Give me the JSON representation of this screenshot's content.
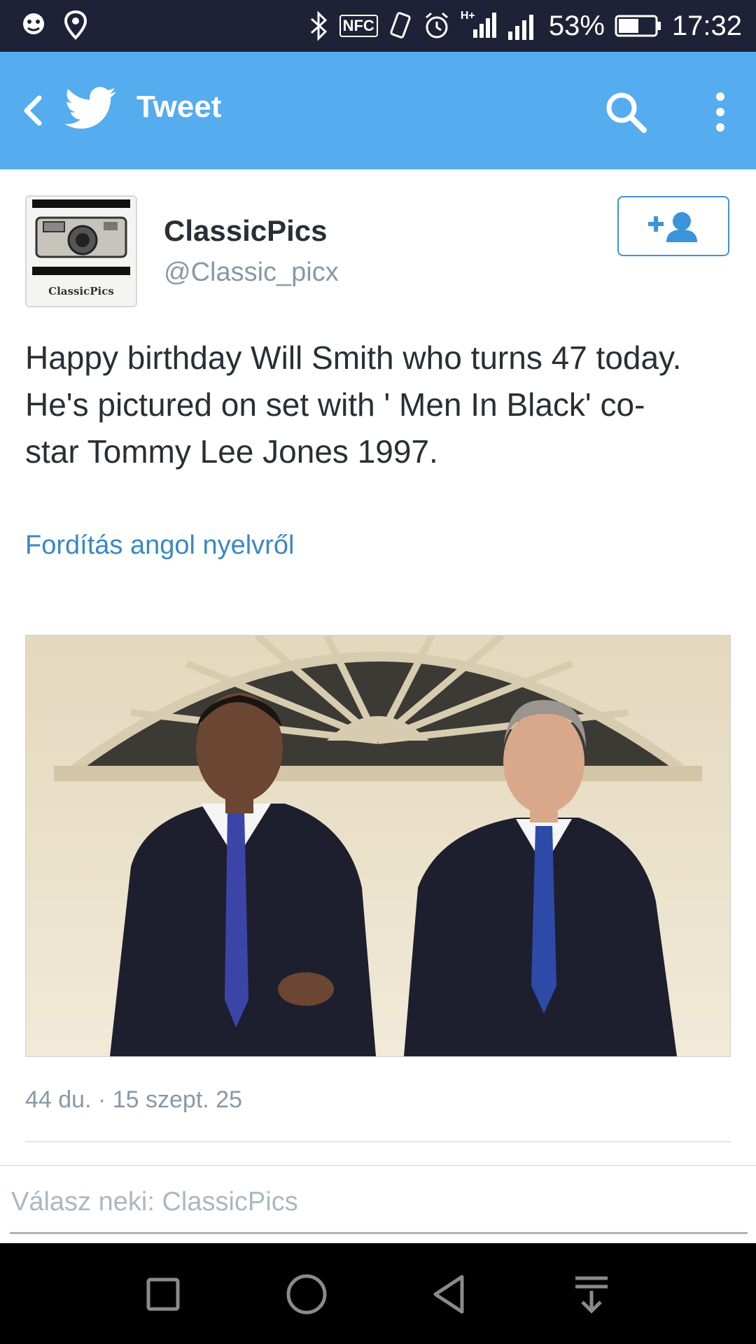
{
  "status_bar": {
    "nfc_label": "NFC",
    "network_label": "H+",
    "battery_percent": "53%",
    "time": "17:32",
    "icons": [
      "notification-icon",
      "location-icon",
      "bluetooth-icon",
      "nfc-icon",
      "vibrate-icon",
      "alarm-icon",
      "signal-icon",
      "signal-icon",
      "battery-icon"
    ]
  },
  "app_bar": {
    "title": "Tweet",
    "background_color": "#55acee",
    "icons": [
      "back-arrow-icon",
      "twitter-bird-icon",
      "search-icon",
      "more-vert-icon"
    ]
  },
  "tweet": {
    "author_name": "ClassicPics",
    "author_handle": "@Classic_picx",
    "avatar_caption": "ClassicPics",
    "text": "Happy birthday Will Smith who turns 47 today. He's pictured on set with ' Men In Black' co-star Tommy Lee Jones 1997.",
    "translate_link": "Fordítás angol nyelvről",
    "timestamp": "44 du. · 15 szept. 25",
    "follow_icon": "add-user-icon",
    "link_color": "#3b88c3"
  },
  "reply": {
    "placeholder": "Válasz neki: ClassicPics"
  },
  "nav_bar": {
    "icons": [
      "recents-square-icon",
      "home-circle-icon",
      "back-triangle-icon",
      "notification-pull-icon"
    ]
  }
}
